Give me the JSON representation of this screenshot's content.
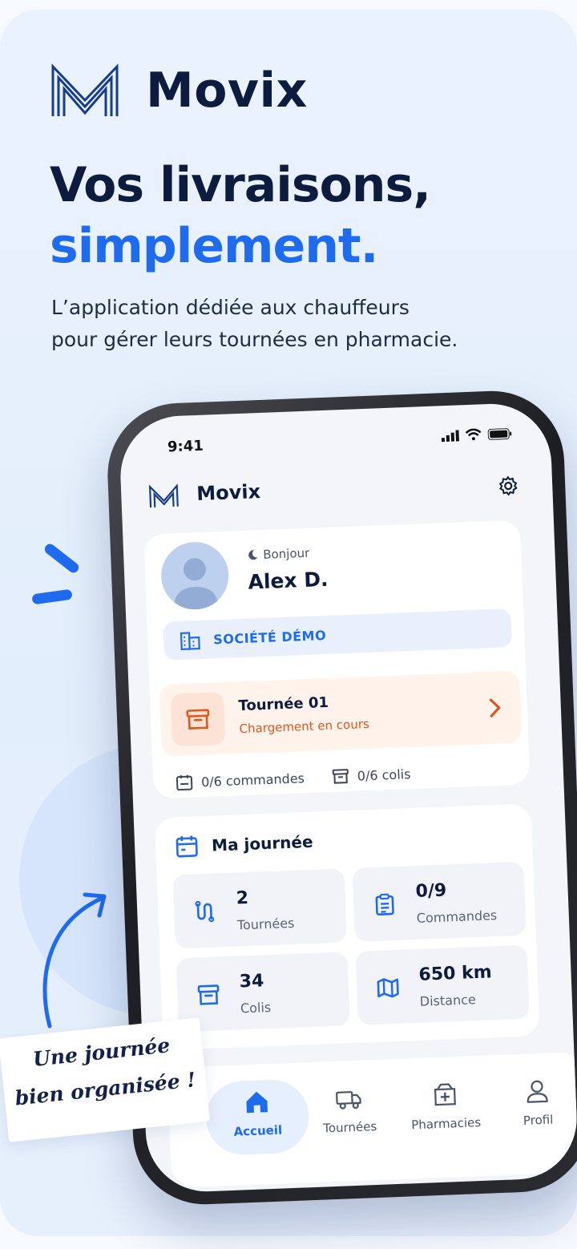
{
  "brand": {
    "name": "Movix"
  },
  "hero": {
    "headline_line1": "Vos livraisons,",
    "headline_line2": "simplement.",
    "subtitle_line1": "L’application dédiée aux chauffeurs",
    "subtitle_line2": "pour gérer leurs tournées en pharmacie."
  },
  "note": {
    "line1": "Une journée",
    "line2": "bien organisée !"
  },
  "colors": {
    "primary": "#1e6bf0",
    "navy": "#0d1b3e",
    "orange": "#e0561b",
    "background": "#eaf2fd"
  },
  "phone": {
    "status_bar": {
      "time": "9:41"
    },
    "app_header": {
      "name": "Movix",
      "settings_icon": "gear-icon"
    },
    "user": {
      "greeting": "Bonjour",
      "name": "Alex D.",
      "company": "SOCIÉTÉ DÉMO"
    },
    "current_tour": {
      "title": "Tournée 01",
      "status": "Chargement en cours",
      "orders": "0/6 commandes",
      "packages": "0/6 colis"
    },
    "day": {
      "title": "Ma journée",
      "tiles": [
        {
          "value": "2",
          "label": "Tournées",
          "icon": "route-icon"
        },
        {
          "value": "0/9",
          "label": "Commandes",
          "icon": "clipboard-icon"
        },
        {
          "value": "34",
          "label": "Colis",
          "icon": "box-icon"
        },
        {
          "value": "650 km",
          "label": "Distance",
          "icon": "map-icon"
        }
      ]
    },
    "nav": [
      {
        "label": "Accueil",
        "icon": "home-icon",
        "active": true
      },
      {
        "label": "Tournées",
        "icon": "truck-icon",
        "active": false
      },
      {
        "label": "Pharmacies",
        "icon": "pharmacy-icon",
        "active": false
      },
      {
        "label": "Profil",
        "icon": "user-icon",
        "active": false
      }
    ]
  }
}
